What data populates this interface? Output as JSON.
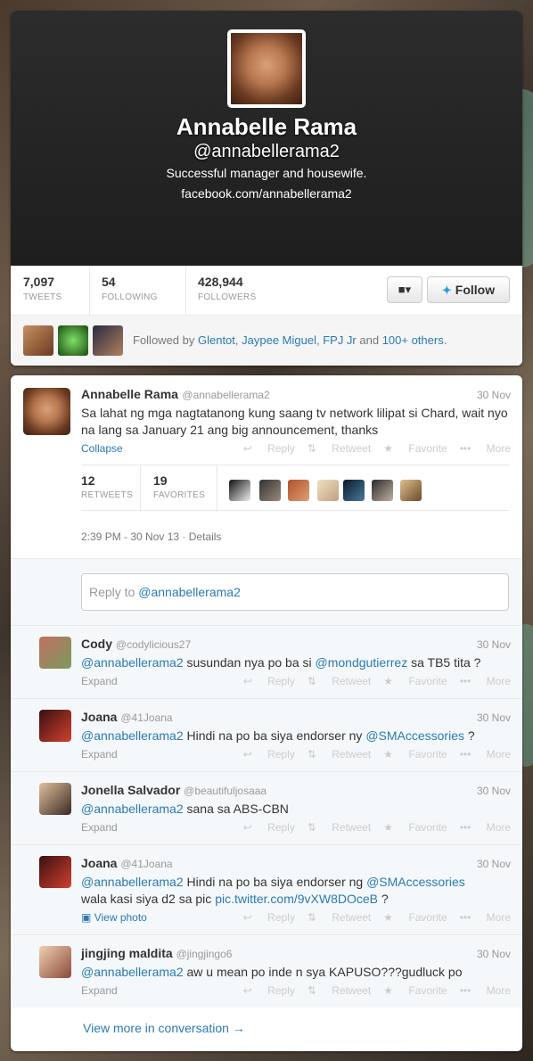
{
  "profile": {
    "name": "Annabelle Rama",
    "handle": "@annabellerama2",
    "bio": "Successful manager and housewife.",
    "url": "facebook.com/annabellerama2",
    "stats": [
      {
        "num": "7,097",
        "label": "TWEETS"
      },
      {
        "num": "54",
        "label": "FOLLOWING"
      },
      {
        "num": "428,944",
        "label": "FOLLOWERS"
      }
    ],
    "follow_label": "Follow",
    "followed_by": {
      "prefix": "Followed by ",
      "names": [
        "Glentot",
        "Jaypee Miguel",
        "FPJ Jr"
      ],
      "sep1": ", ",
      "sep2": ", ",
      "sep3": " and ",
      "others": "100+ others",
      "suffix": "."
    }
  },
  "main_tweet": {
    "name": "Annabelle Rama",
    "screen": "@annabellerama2",
    "time": "30 Nov",
    "text": "Sa lahat ng mga nagtatanong kung saang tv network lilipat si Chard, wait nyo na lang sa January 21 ang big announcement, thanks",
    "collapse": "Collapse",
    "retweets": {
      "num": "12",
      "label": "RETWEETS"
    },
    "favorites": {
      "num": "19",
      "label": "FAVORITES"
    },
    "dateline": "2:39 PM - 30 Nov 13",
    "details": "Details"
  },
  "actions": {
    "reply": "Reply",
    "retweet": "Retweet",
    "favorite": "Favorite",
    "more": "More"
  },
  "reply_box": {
    "prefix": "Reply to ",
    "handle": "@annabellerama2"
  },
  "replies": [
    {
      "name": "Cody",
      "screen": "@codylicious27",
      "time": "30 Nov",
      "line1_mention": "@annabellerama2",
      "line1": " susundan nya po ba si ",
      "mention2": "@mondgutierrez",
      "line1b": " sa TB5 tita ?",
      "expand": "Expand"
    },
    {
      "name": "Joana",
      "screen": "@41Joana",
      "time": "30 Nov",
      "line1_mention": "@annabellerama2",
      "line1": " Hindi na po ba siya endorser ny ",
      "mention2": "@SMAccessories",
      "line1b": " ?",
      "expand": "Expand"
    },
    {
      "name": "Jonella Salvador",
      "screen": "@beautifuljosaaa",
      "time": "30 Nov",
      "line1_mention": "@annabellerama2",
      "line1": " sana sa ABS-CBN",
      "mention2": "",
      "line1b": "",
      "expand": "Expand"
    },
    {
      "name": "Joana",
      "screen": "@41Joana",
      "time": "30 Nov",
      "line1_mention": "@annabellerama2",
      "line1": "  Hindi na po ba siya endorser ng ",
      "mention2": "@SMAccessories",
      "line1b": "",
      "line2": "wala kasi siya d2 sa pic ",
      "link2": "pic.twitter.com/9vXW8DOceB",
      "line2b": " ?",
      "expand": "View photo"
    },
    {
      "name": "jingjing maldita",
      "screen": "@jingjingo6",
      "time": "30 Nov",
      "line1_mention": "@annabellerama2",
      "line1": " aw u mean po inde n sya KAPUSO???gudluck po",
      "mention2": "",
      "line1b": "",
      "expand": "Expand"
    }
  ],
  "view_more": "View more in conversation →",
  "colors": {
    "link": "#2a7ab0",
    "header_bg": "#1e1e1e",
    "bird": "#2a9bd8"
  }
}
